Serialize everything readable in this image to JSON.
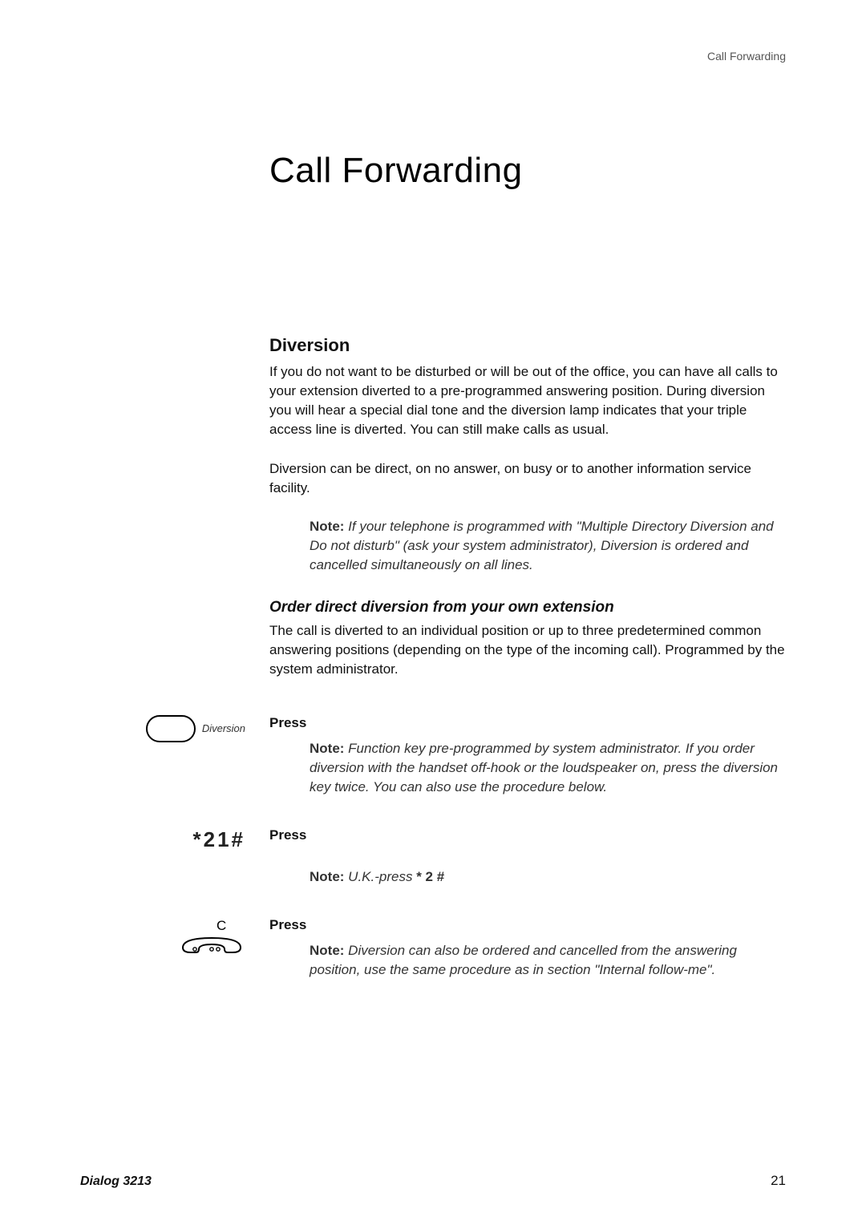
{
  "header": {
    "label": "Call Forwarding"
  },
  "title": "Call Forwarding",
  "section": {
    "heading": "Diversion",
    "para1": "If you do not want to be disturbed or will be out of the office, you can have all calls to your extension diverted to a pre-programmed answering position. During diversion you will hear a special dial tone and the diversion lamp indicates that your triple access line is diverted. You can still make calls as usual.",
    "para2": "Diversion can be direct, on no answer, on busy or to another information service facility.",
    "note1_label": "Note:",
    "note1_text": " If your telephone is programmed with \"Multiple Directory Diversion and Do not disturb\" (ask your system administrator), Diversion is ordered and cancelled simultaneously on all lines.",
    "subheading": "Order direct diversion from your own extension",
    "para3": "The call is diverted to an individual position or up to three predetermined common answering positions (depending on the type of the incoming call). Programmed by the system administrator."
  },
  "steps": {
    "diversion_key_label": "Diversion",
    "press": "Press",
    "note2_label": "Note:",
    "note2_text": " Function key pre-programmed by system administrator. If you order diversion with the handset off-hook or the loudspeaker on, press the diversion key twice. You can also use the procedure below.",
    "code": "*21#",
    "note3_label": "Note:",
    "note3_text_prefix": " U.K.-press ",
    "note3_code": "* 2 #",
    "note4_label": "Note:",
    "note4_text": " Diversion can also be ordered and cancelled from the answering position, use the same procedure as in section \"Internal follow-me\"."
  },
  "footer": {
    "model": "Dialog 3213",
    "page": "21"
  }
}
